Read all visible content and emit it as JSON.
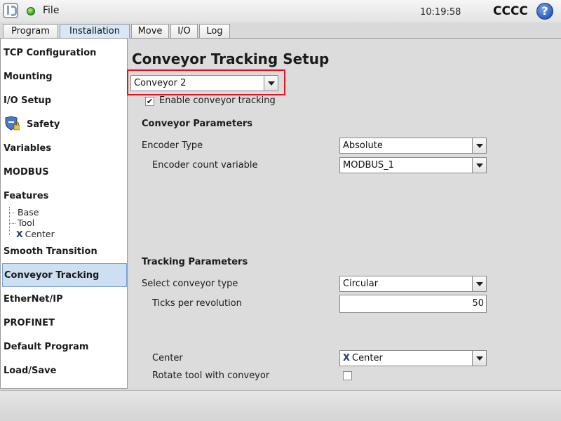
{
  "topbar": {
    "file_label": "File",
    "clock": "10:19:58",
    "robot_name": "CCCC",
    "help_label": "?"
  },
  "tabs": [
    {
      "label": "Program",
      "active": false
    },
    {
      "label": "Installation",
      "active": true
    },
    {
      "label": "Move",
      "active": false
    },
    {
      "label": "I/O",
      "active": false
    },
    {
      "label": "Log",
      "active": false
    }
  ],
  "sidebar": {
    "items": [
      {
        "label": "TCP Configuration"
      },
      {
        "label": "Mounting"
      },
      {
        "label": "I/O Setup"
      },
      {
        "label": "Safety"
      },
      {
        "label": "Variables"
      },
      {
        "label": "MODBUS"
      },
      {
        "label": "Features"
      },
      {
        "label": "Smooth Transition"
      },
      {
        "label": "Conveyor Tracking",
        "active": true
      },
      {
        "label": "EtherNet/IP"
      },
      {
        "label": "PROFINET"
      },
      {
        "label": "Default Program"
      },
      {
        "label": "Load/Save"
      }
    ],
    "features_tree": [
      "Base",
      "Tool",
      "Center"
    ]
  },
  "main": {
    "title": "Conveyor Tracking Setup",
    "conveyor_select": "Conveyor 2",
    "enable_label": "Enable conveyor tracking",
    "enable_checked": true,
    "conveyor_params": {
      "heading": "Conveyor Parameters",
      "encoder_type_label": "Encoder Type",
      "encoder_type_value": "Absolute",
      "encoder_count_label": "Encoder count variable",
      "encoder_count_value": "MODBUS_1"
    },
    "tracking_params": {
      "heading": "Tracking Parameters",
      "conveyor_type_label": "Select conveyor type",
      "conveyor_type_value": "Circular",
      "ticks_label": "Ticks per revolution",
      "ticks_value": "50",
      "center_label": "Center",
      "center_value": "Center",
      "rotate_label": "Rotate tool with conveyor",
      "rotate_checked": false
    }
  },
  "colors": {
    "highlight_frame": "#e0141e",
    "active_selection": "#cddff2"
  }
}
